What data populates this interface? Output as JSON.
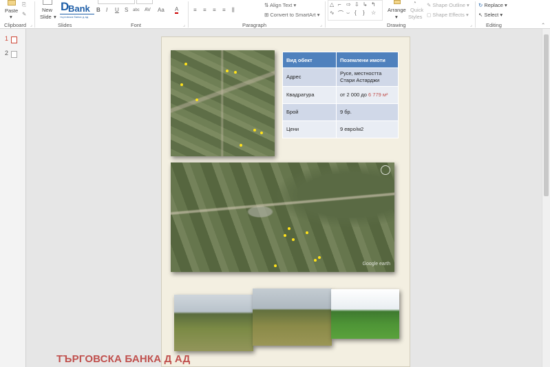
{
  "ribbon": {
    "groups": {
      "clipboard": "Clipboard",
      "slides": "Slides",
      "font": "Font",
      "paragraph": "Paragraph",
      "drawing": "Drawing",
      "editing": "Editing"
    },
    "paste": "Paste",
    "new_slide_1": "New",
    "new_slide_2": "Slide",
    "align_text": "Align Text",
    "convert_smartart": "Convert to SmartArt",
    "arrange": "Arrange",
    "quick_styles_1": "Quick",
    "quick_styles_2": "Styles",
    "shape_outline": "Shape Outline",
    "shape_effects": "Shape Effects",
    "replace": "Replace",
    "select": "Select",
    "font_bold": "B",
    "font_italic": "I",
    "font_underline": "U",
    "font_strike": "S",
    "font_shadow": "abc",
    "font_spacing": "AV",
    "font_case": "Aa",
    "font_color": "A"
  },
  "logo": {
    "d": "D",
    "bank": "Bank",
    "sub": "търговска банка д ад"
  },
  "thumbnails": [
    {
      "num": "1",
      "active": true
    },
    {
      "num": "2",
      "active": false
    }
  ],
  "table": {
    "headers": [
      "Вид обект",
      "Поземлени имоти"
    ],
    "rows": [
      [
        "Адрес",
        "Русе, местността Стари Астарджи"
      ],
      [
        "Квадратура",
        "от 2 000 до ",
        "6 779 м²"
      ],
      [
        "Брой",
        "9 бр."
      ],
      [
        "Цени",
        "9 евро/м2"
      ]
    ]
  },
  "bank_name": "ТЪРГОВСКА БАНКА Д АД",
  "google_earth": "Google earth",
  "colors": {
    "header_blue": "#4f81bd",
    "row_odd": "#d0d8e8",
    "row_even": "#e9edf4",
    "accent_red": "#c0504d",
    "brand_blue": "#1f5fa8"
  }
}
